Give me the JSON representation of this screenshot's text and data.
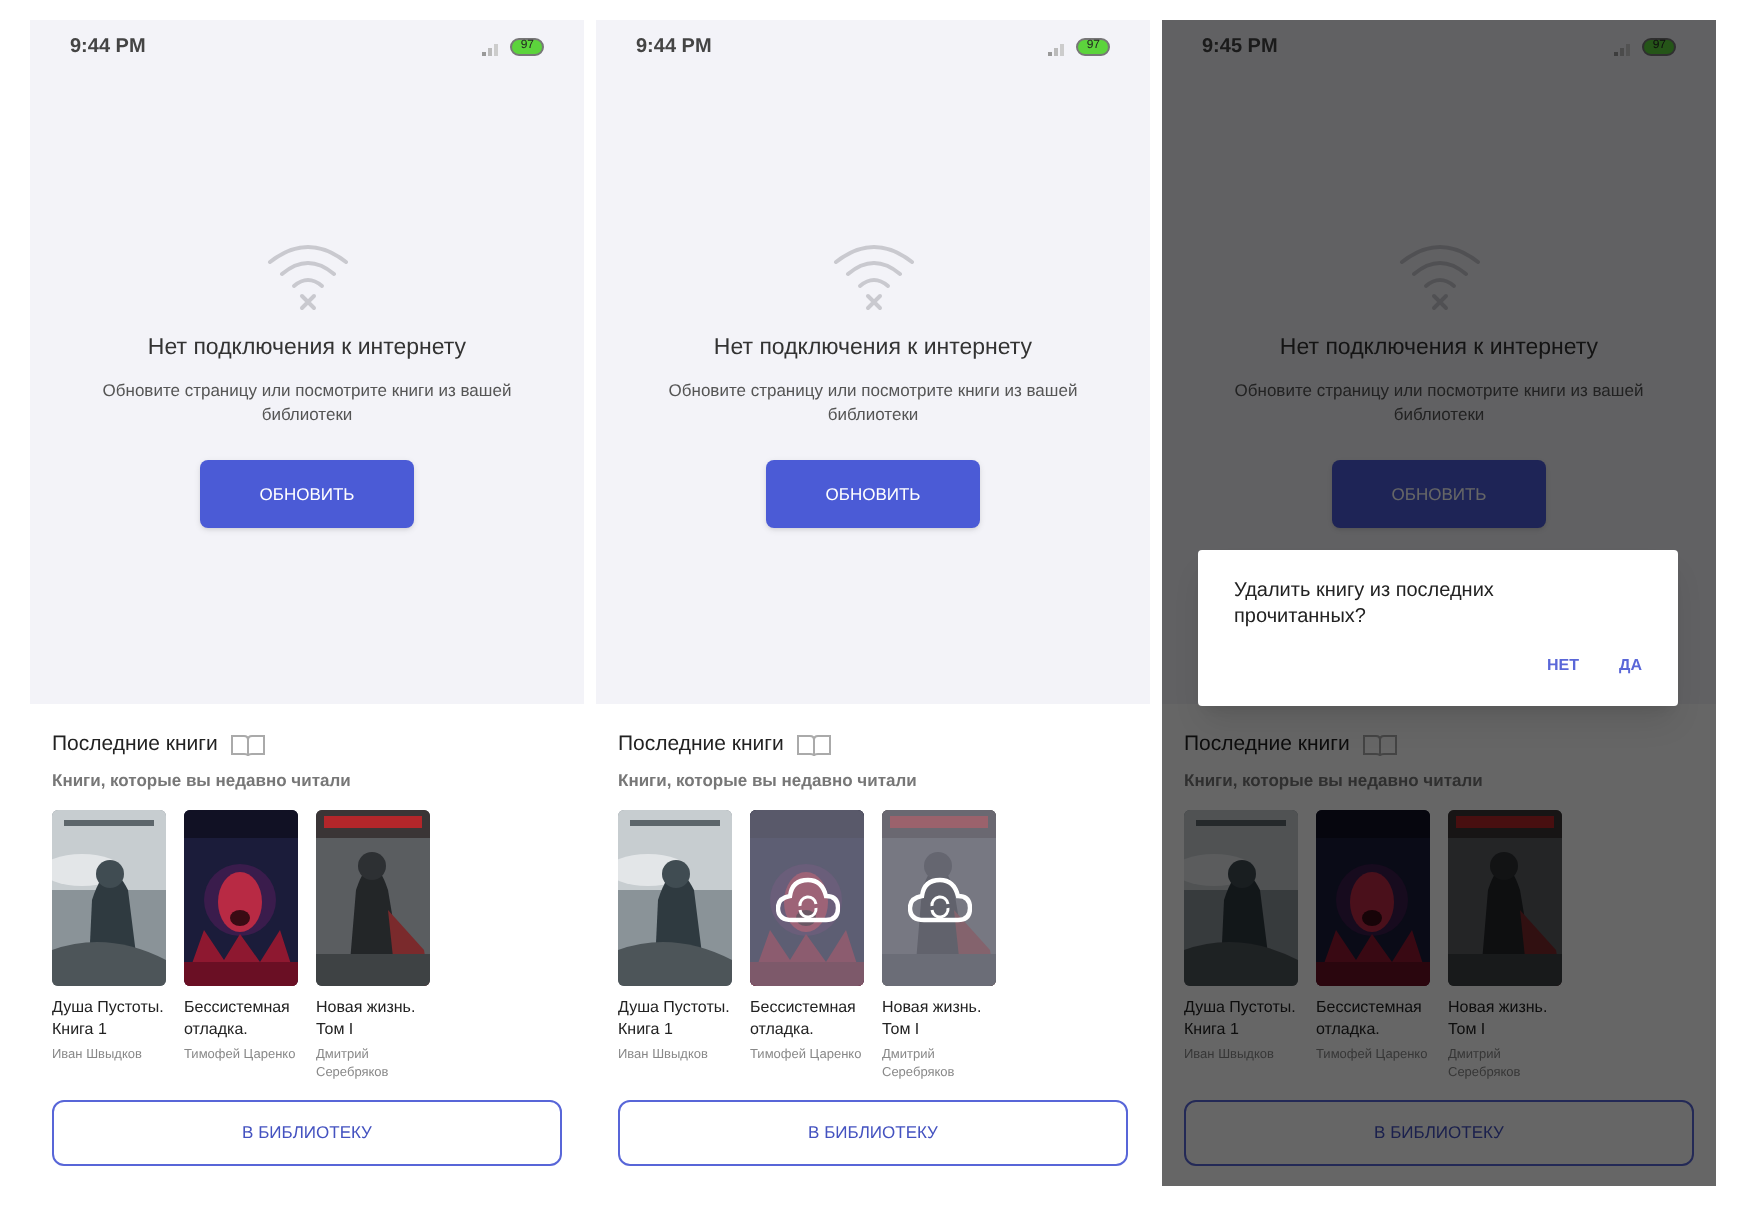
{
  "screens": [
    {
      "status_bar": {
        "time": "9:44 PM",
        "battery": "97"
      },
      "offline": {
        "title": "Нет подключения к интернету",
        "message": "Обновите страницу или посмотрите книги из вашей библиотеки",
        "button": "ОБНОВИТЬ"
      },
      "recent": {
        "title": "Последние книги",
        "subtitle": "Книги, которые вы недавно читали",
        "books": [
          {
            "title": "Душа Пустоты. Книга 1",
            "author": "Иван Швыдков",
            "syncing": false
          },
          {
            "title": "Бессистемная отладка.",
            "author": "Тимофей Царенко",
            "syncing": false
          },
          {
            "title": "Новая жизнь. Том I",
            "author": "Дмитрий Серебряков",
            "syncing": false
          }
        ]
      },
      "library_button": "В БИБЛИОТЕКУ"
    },
    {
      "status_bar": {
        "time": "9:44 PM",
        "battery": "97"
      },
      "offline": {
        "title": "Нет подключения к интернету",
        "message": "Обновите страницу или посмотрите книги из вашей библиотеки",
        "button": "ОБНОВИТЬ"
      },
      "recent": {
        "title": "Последние книги",
        "subtitle": "Книги, которые вы недавно читали",
        "books": [
          {
            "title": "Душа Пустоты. Книга 1",
            "author": "Иван Швыдков",
            "syncing": false
          },
          {
            "title": "Бессистемная отладка.",
            "author": "Тимофей Царенко",
            "syncing": true
          },
          {
            "title": "Новая жизнь. Том I",
            "author": "Дмитрий Серебряков",
            "syncing": true
          }
        ]
      },
      "library_button": "В БИБЛИОТЕКУ"
    },
    {
      "status_bar": {
        "time": "9:45 PM",
        "battery": "97"
      },
      "offline": {
        "title": "Нет подключения к интернету",
        "message": "Обновите страницу или посмотрите книги из вашей библиотеки",
        "button": "ОБНОВИТЬ"
      },
      "recent": {
        "title": "Последние книги",
        "subtitle": "Книги, которые вы недавно читали",
        "books": [
          {
            "title": "Душа Пустоты. Книга 1",
            "author": "Иван Швыдков",
            "syncing": false
          },
          {
            "title": "Бессистемная отладка.",
            "author": "Тимофей Царенко",
            "syncing": false
          },
          {
            "title": "Новая жизнь. Том I",
            "author": "Дмитрий Серебряков",
            "syncing": false
          }
        ]
      },
      "library_button": "В БИБЛИОТЕКУ",
      "dialog": {
        "message": "Удалить книгу из последних прочитанных?",
        "buttons": [
          "НЕТ",
          "ДА"
        ]
      }
    }
  ]
}
